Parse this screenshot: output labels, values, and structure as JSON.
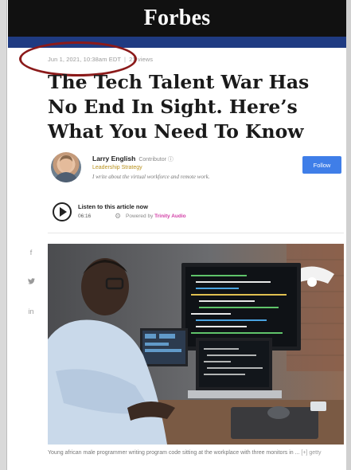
{
  "header": {
    "logo": "Forbes"
  },
  "article": {
    "meta": {
      "date": "Jun 1, 2021, 10:38am EDT",
      "views": "21 views"
    },
    "title": "The Tech Talent War Has No End In Sight. Here’s What You Need To Know",
    "author": {
      "name": "Larry English",
      "role": "Contributor ⓘ",
      "channel": "Leadership Strategy",
      "bio": "I write about the virtual workforce and remote work."
    },
    "follow_label": "Follow",
    "audio": {
      "label": "Listen to this article now",
      "duration": "06:16",
      "powered_prefix": "Powered by",
      "powered_brand": "Trinity Audio"
    },
    "social": [
      "f",
      "𝕪",
      "in"
    ],
    "image_caption": "Young african male programmer writing program code sitting at the workplace with three monitors in ...",
    "caption_expand": "[+]",
    "caption_credit": "getty"
  },
  "colors": {
    "header_bg": "#111111",
    "brand_strip": "#1f3b82",
    "follow_button": "#3f7ee8",
    "channel_gold": "#b9931f",
    "annotation_circle": "#8b1a1a",
    "trinity_pink": "#d23ea6"
  }
}
